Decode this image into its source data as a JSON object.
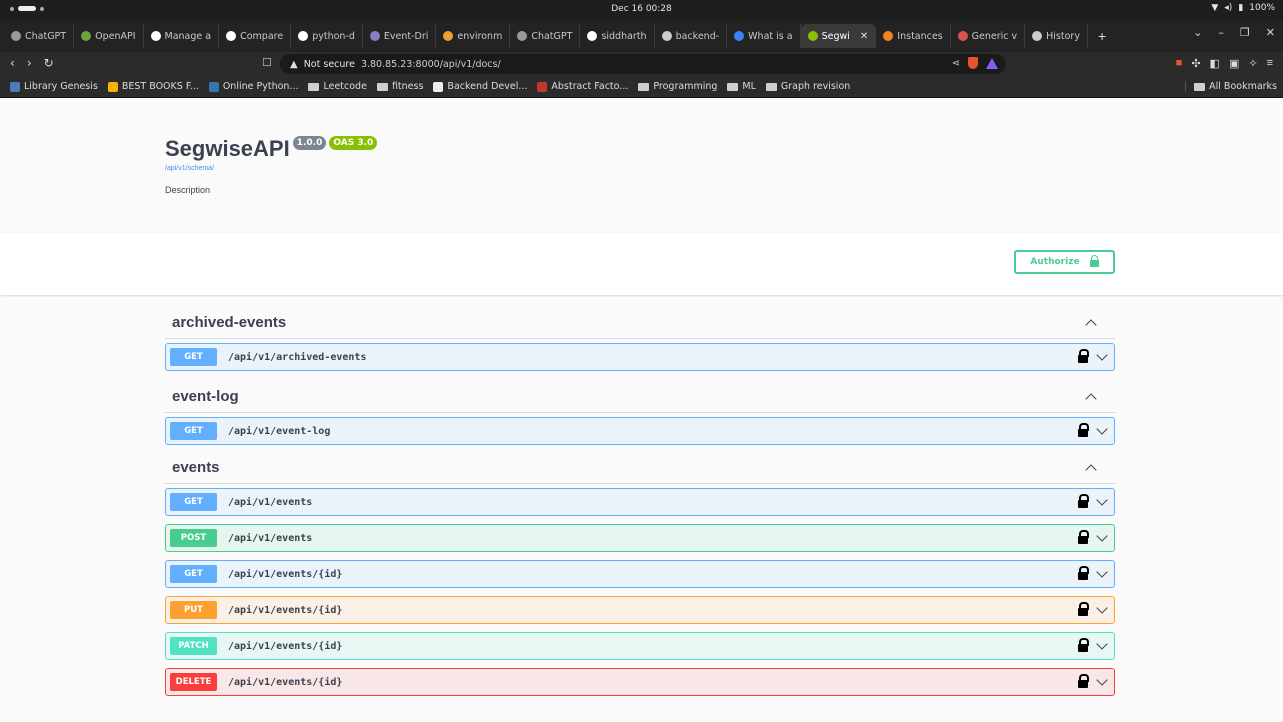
{
  "os": {
    "clock": "Dec 16 00:28",
    "battery": "100%"
  },
  "tabs": [
    {
      "label": "ChatGPT",
      "color": "#9a9a9a"
    },
    {
      "label": "OpenAPI",
      "color": "#6ba539"
    },
    {
      "label": "Manage a",
      "color": "#ffffff"
    },
    {
      "label": "Compare",
      "color": "#ffffff"
    },
    {
      "label": "python-d",
      "color": "#ffffff"
    },
    {
      "label": "Event-Dri",
      "color": "#8e7cc3"
    },
    {
      "label": "environm",
      "color": "#f0a030"
    },
    {
      "label": "ChatGPT",
      "color": "#9a9a9a"
    },
    {
      "label": "siddharth",
      "color": "#ffffff"
    },
    {
      "label": "backend-",
      "color": "#cccccc"
    },
    {
      "label": "What is a",
      "color": "#3b82f6"
    },
    {
      "label": "Segwi",
      "color": "#89bf04",
      "active": true
    },
    {
      "label": "Instances",
      "color": "#f48120"
    },
    {
      "label": "Generic v",
      "color": "#d9534f"
    },
    {
      "label": "History",
      "color": "#cccccc"
    }
  ],
  "address": {
    "security": "Not secure",
    "url": "3.80.85.23:8000/api/v1/docs/"
  },
  "bookmarks": [
    {
      "label": "Library Genesis",
      "type": "site",
      "color": "#4a7ebb"
    },
    {
      "label": "BEST BOOKS F...",
      "type": "site",
      "color": "#f4b400"
    },
    {
      "label": "Online Python...",
      "type": "site",
      "color": "#3776ab"
    },
    {
      "label": "Leetcode",
      "type": "folder"
    },
    {
      "label": "fitness",
      "type": "folder"
    },
    {
      "label": "Backend Devel...",
      "type": "site",
      "color": "#eeeeee"
    },
    {
      "label": "Abstract Facto...",
      "type": "site",
      "color": "#c0392b"
    },
    {
      "label": "Programming",
      "type": "folder"
    },
    {
      "label": "ML",
      "type": "folder"
    },
    {
      "label": "Graph revision",
      "type": "folder"
    }
  ],
  "all_bookmarks": "All Bookmarks",
  "api": {
    "title": "SegwiseAPI",
    "version": "1.0.0",
    "oas": "OAS 3.0",
    "schema_link": "/api/v1/schema/",
    "description": "Description"
  },
  "authorize_label": "Authorize",
  "sections": [
    {
      "name": "archived-events",
      "ops": [
        {
          "method": "GET",
          "path": "/api/v1/archived-events"
        }
      ]
    },
    {
      "name": "event-log",
      "ops": [
        {
          "method": "GET",
          "path": "/api/v1/event-log"
        }
      ]
    },
    {
      "name": "events",
      "ops": [
        {
          "method": "GET",
          "path": "/api/v1/events"
        },
        {
          "method": "POST",
          "path": "/api/v1/events"
        },
        {
          "method": "GET",
          "path": "/api/v1/events/{id}"
        },
        {
          "method": "PUT",
          "path": "/api/v1/events/{id}"
        },
        {
          "method": "PATCH",
          "path": "/api/v1/events/{id}"
        },
        {
          "method": "DELETE",
          "path": "/api/v1/events/{id}"
        }
      ]
    }
  ]
}
